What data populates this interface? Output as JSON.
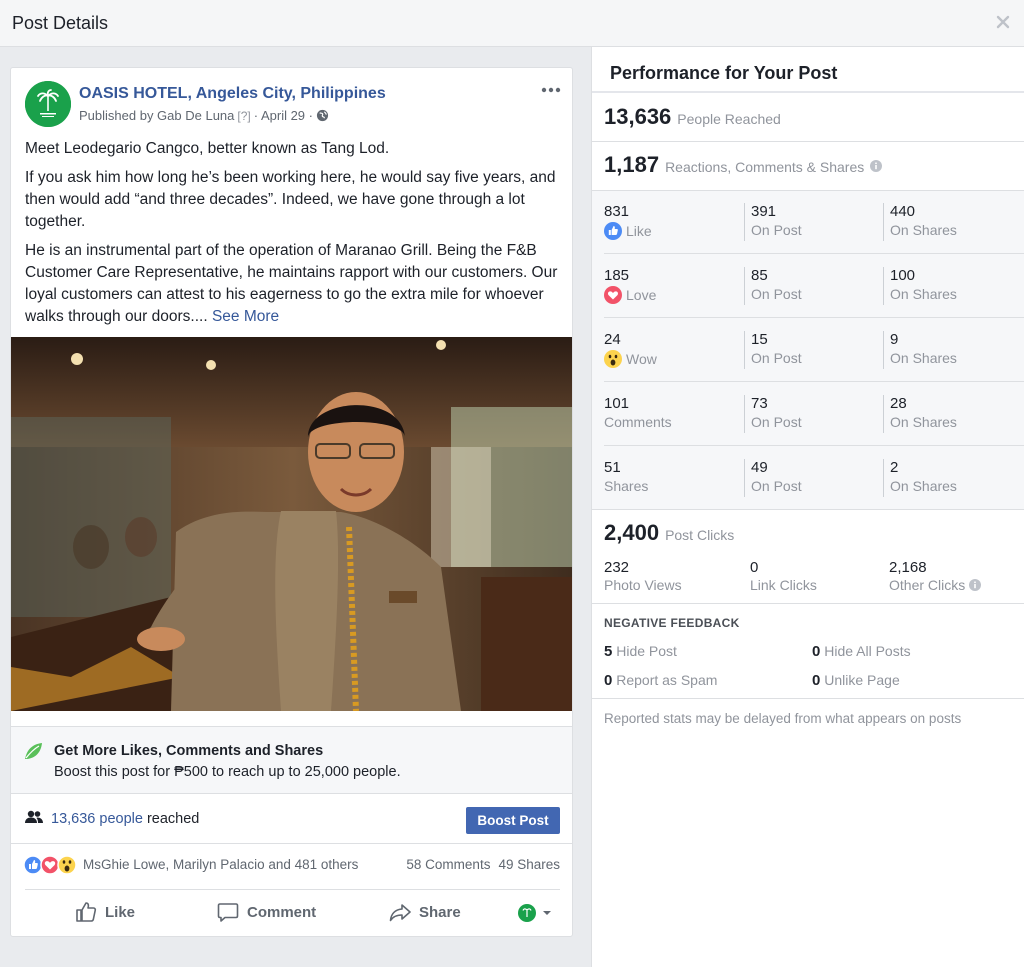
{
  "header": {
    "title": "Post Details",
    "close_icon": "close-icon"
  },
  "post": {
    "page_name": "OASIS HOTEL, Angeles City, Philippines",
    "published_by": "Published by Gab De Luna",
    "question_mark": "[?]",
    "date": "· April 29 ·",
    "paragraphs": [
      "Meet Leodegario Cangco, better known as Tang Lod.",
      "If you ask him how long he’s been working here, he would say five years, and then would add “and three decades”. Indeed, we have gone through a lot together.",
      "He is an instrumental part of the operation of Maranao Grill. Being the F&B Customer Care Representative, he maintains rapport with our customers. Our loyal customers can attest to his eagerness to go the extra mile for whoever walks through our doors...."
    ],
    "see_more": "See More"
  },
  "boost": {
    "title": "Get More Likes, Comments and Shares",
    "subtitle": "Boost this post for ₱500 to reach up to 25,000 people.",
    "reach_link": "13,636 people",
    "reach_suffix": " reached",
    "button": "Boost Post"
  },
  "reactions": {
    "names": "MsGhie Lowe, Marilyn Palacio and 481 others",
    "comments": "58 Comments",
    "shares": "49 Shares"
  },
  "actions": {
    "like": "Like",
    "comment": "Comment",
    "share": "Share"
  },
  "performance": {
    "title": "Performance for Your Post",
    "reached_num": "13,636",
    "reached_label": "People Reached",
    "engagement_num": "1,187",
    "engagement_label": "Reactions, Comments & Shares",
    "rows": [
      {
        "n1": "831",
        "l1": "Like",
        "n2": "391",
        "l2": "On Post",
        "n3": "440",
        "l3": "On Shares"
      },
      {
        "n1": "185",
        "l1": "Love",
        "n2": "85",
        "l2": "On Post",
        "n3": "100",
        "l3": "On Shares"
      },
      {
        "n1": "24",
        "l1": "Wow",
        "n2": "15",
        "l2": "On Post",
        "n3": "9",
        "l3": "On Shares"
      },
      {
        "n1": "101",
        "l1": "Comments",
        "n2": "73",
        "l2": "On Post",
        "n3": "28",
        "l3": "On Shares"
      },
      {
        "n1": "51",
        "l1": "Shares",
        "n2": "49",
        "l2": "On Post",
        "n3": "2",
        "l3": "On Shares"
      }
    ],
    "clicks_num": "2,400",
    "clicks_label": "Post Clicks",
    "photo_views_num": "232",
    "photo_views_label": "Photo Views",
    "link_clicks_num": "0",
    "link_clicks_label": "Link Clicks",
    "other_clicks_num": "2,168",
    "other_clicks_label": "Other Clicks",
    "negative_title": "NEGATIVE FEEDBACK",
    "hide_post_num": "5",
    "hide_post_label": "Hide Post",
    "hide_all_num": "0",
    "hide_all_label": "Hide All Posts",
    "spam_num": "0",
    "spam_label": "Report as Spam",
    "unlike_num": "0",
    "unlike_label": "Unlike Page",
    "footer": "Reported stats may be delayed from what appears on posts"
  },
  "colors": {
    "link": "#365899",
    "accent": "#4267b2",
    "brand_green": "#1aa14b"
  }
}
